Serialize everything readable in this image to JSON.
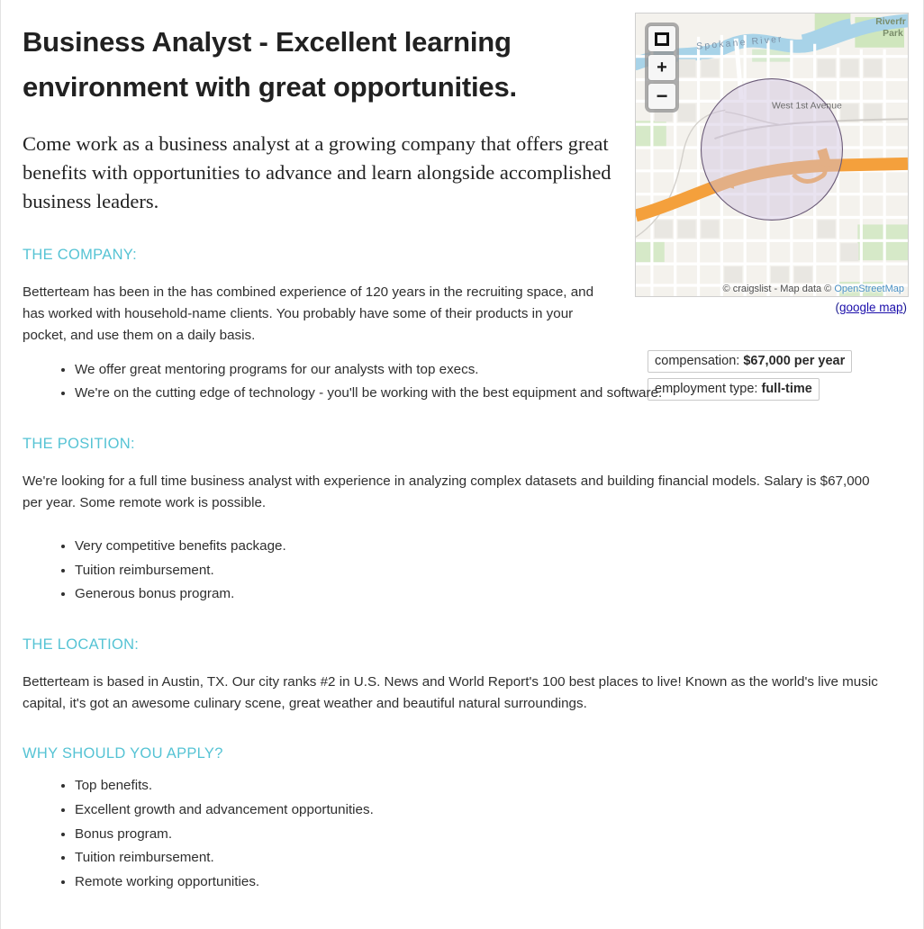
{
  "colors": {
    "section_heading": "#55c3d4",
    "link": "#1a0dab",
    "osm_link": "#4a90c4",
    "text": "#2f2f2f",
    "map_highway": "#f4a03c",
    "map_circle": "#d9c9e4",
    "map_water": "#a8d3e8",
    "map_park": "#cfe6bd"
  },
  "posting": {
    "title": "Business Analyst - Excellent learning environment with great opportunities.",
    "lede": "Come work as a business analyst at a growing company that offers great benefits with opportunities to advance and learn alongside accomplished business leaders.",
    "sections": [
      {
        "heading": "THE COMPANY:",
        "paragraph": "Betterteam has been in the has combined experience of 120 years in the recruiting space, and has worked with household-name clients. You probably have some of their products in your pocket, and use them on a daily basis.",
        "bullets": [
          "We offer great mentoring programs for our analysts with top execs.",
          "We're on the cutting edge of technology - you'll be working with the best equipment and software."
        ]
      },
      {
        "heading": "THE POSITION:",
        "paragraph": "We're looking for a full time business analyst with experience in analyzing complex datasets and building financial models. Salary is $67,000 per year. Some remote work is possible.",
        "bullets": [
          "Very competitive benefits package.",
          "Tuition reimbursement.",
          "Generous bonus program."
        ]
      },
      {
        "heading": "THE LOCATION:",
        "paragraph": "Betterteam is based in Austin, TX. Our city ranks #2 in U.S. News and World Report's 100 best places to live! Known as the world's live music capital, it's got an awesome culinary scene, great weather and beautiful natural surroundings.",
        "bullets": []
      },
      {
        "heading": "WHY SHOULD YOU APPLY?",
        "paragraph": "",
        "bullets": [
          "Top benefits.",
          "Excellent growth and advancement opportunities.",
          "Bonus program.",
          "Tuition reimbursement.",
          "Remote working opportunities."
        ]
      }
    ]
  },
  "map": {
    "controls": {
      "fullscreen_label": "",
      "zoom_in_label": "+",
      "zoom_out_label": "−"
    },
    "labels": {
      "river": "Spokane River",
      "avenue": "West 1st Avenue",
      "park": "Riverfr Park"
    },
    "attribution_prefix": "© craigslist - Map data © ",
    "attribution_osm": "OpenStreetMap",
    "google_map_open": "(",
    "google_map_link": "google map",
    "google_map_close": ")"
  },
  "attributes": [
    {
      "label": "compensation: ",
      "value": "$67,000 per year"
    },
    {
      "label": "employment type: ",
      "value": "full-time"
    }
  ]
}
